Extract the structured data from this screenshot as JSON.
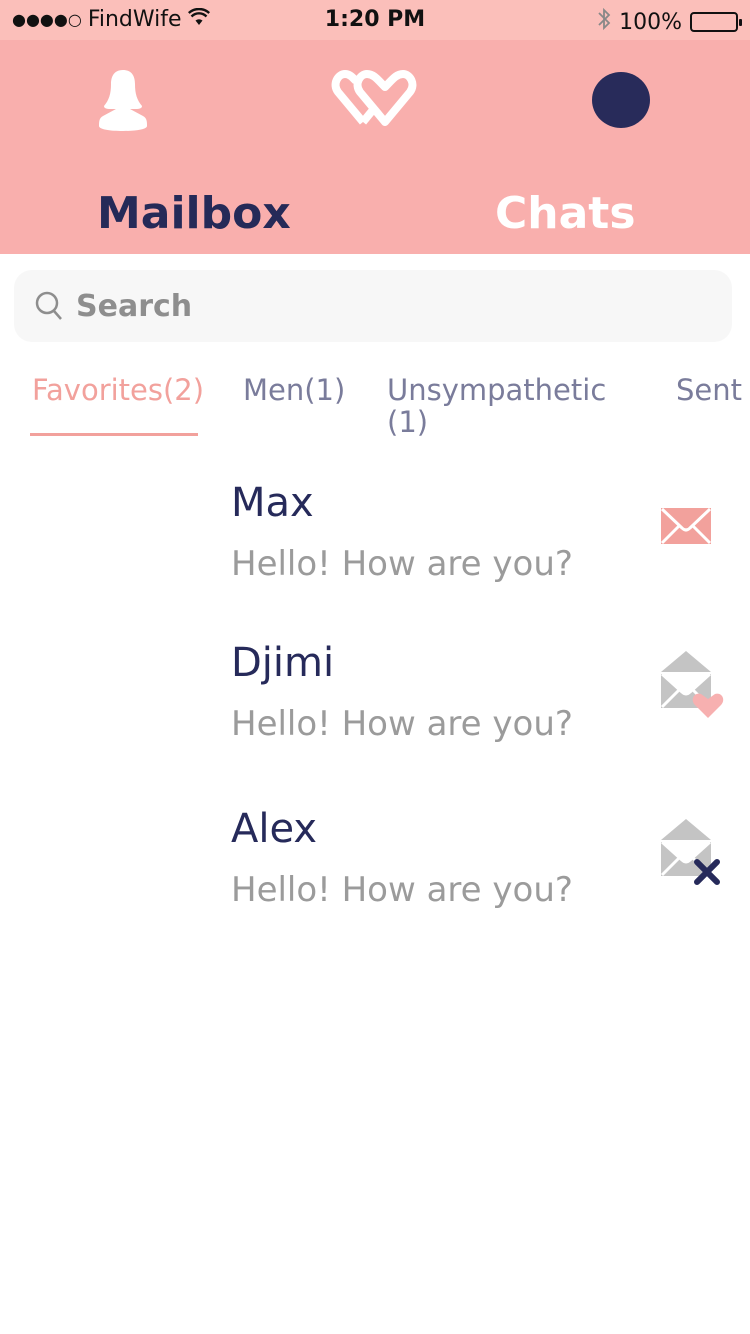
{
  "status_bar": {
    "carrier": "FindWife",
    "signal": "●●●●○",
    "time": "1:20 PM",
    "battery": "100%",
    "icons": [
      "wifi-icon",
      "bluetooth-icon",
      "battery-icon"
    ]
  },
  "header": {
    "icons": [
      "profile-icon",
      "hearts-logo-icon",
      "avatar-dot"
    ],
    "tabs": [
      {
        "label": "Mailbox",
        "active": true
      },
      {
        "label": "Chats",
        "active": false
      }
    ]
  },
  "search": {
    "placeholder": "Search",
    "value": ""
  },
  "filters": [
    {
      "label": "Favorites(2)",
      "active": true
    },
    {
      "label": "Men(1)",
      "active": false
    },
    {
      "label": "Unsympathetic(1)",
      "active": false
    },
    {
      "label": "Sent",
      "active": false
    }
  ],
  "messages": [
    {
      "name": "Max",
      "preview": "Hello! How are you?",
      "status_icon": "envelope-unread-icon"
    },
    {
      "name": "Djimi",
      "preview": "Hello! How are you?",
      "status_icon": "envelope-open-heart-icon"
    },
    {
      "name": "Alex",
      "preview": "Hello! How are you?",
      "status_icon": "envelope-open-x-icon"
    }
  ],
  "colors": {
    "header_bg": "#f9afad",
    "status_bar_bg": "#fbbfba",
    "navy": "#262a5a",
    "accent_pink": "#f2a19c",
    "muted_gray": "#9b9b9b"
  }
}
